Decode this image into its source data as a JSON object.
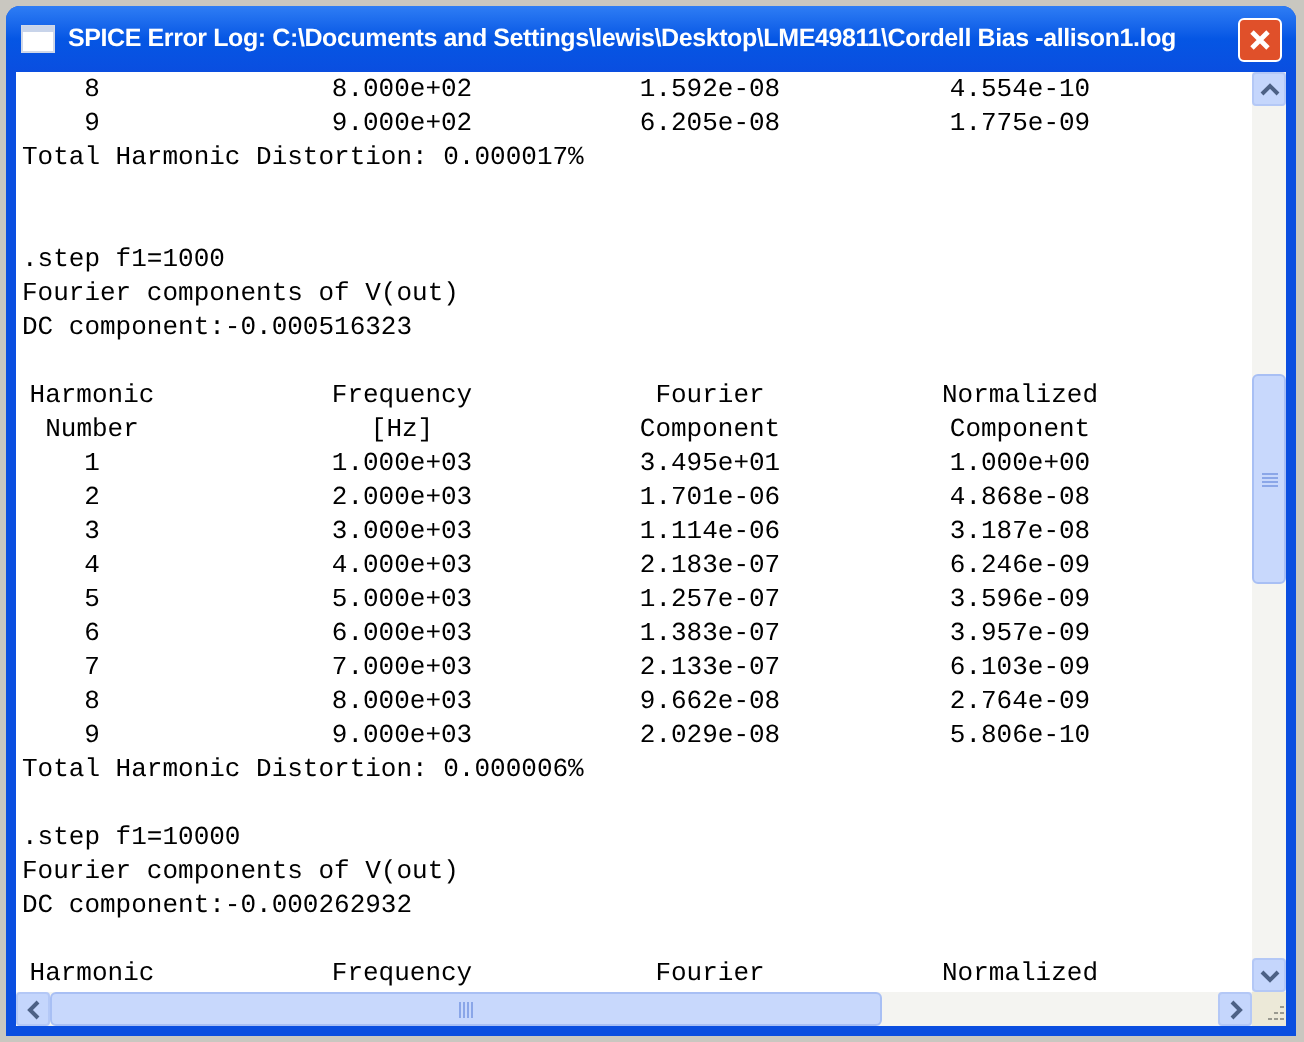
{
  "window": {
    "title": "SPICE Error Log: C:\\Documents and Settings\\lewis\\Desktop\\LME49811\\Cordell Bias -allison1.log"
  },
  "log": [
    {
      "kind": "row",
      "cells": [
        "8",
        "8.000e+02",
        "1.592e-08",
        "4.554e-10"
      ]
    },
    {
      "kind": "row",
      "cells": [
        "9",
        "9.000e+02",
        "6.205e-08",
        "1.775e-09"
      ]
    },
    {
      "kind": "text",
      "text": "Total Harmonic Distortion: 0.000017%"
    },
    {
      "kind": "blank"
    },
    {
      "kind": "blank"
    },
    {
      "kind": "text",
      "text": ".step f1=1000"
    },
    {
      "kind": "text",
      "text": "Fourier components of V(out)"
    },
    {
      "kind": "text",
      "text": "DC component:-0.000516323"
    },
    {
      "kind": "blank"
    },
    {
      "kind": "row",
      "cells": [
        "Harmonic",
        "Frequency",
        "Fourier",
        "Normalized"
      ]
    },
    {
      "kind": "row",
      "cells": [
        "Number",
        "[Hz]",
        "Component",
        "Component"
      ]
    },
    {
      "kind": "row",
      "cells": [
        "1",
        "1.000e+03",
        "3.495e+01",
        "1.000e+00"
      ]
    },
    {
      "kind": "row",
      "cells": [
        "2",
        "2.000e+03",
        "1.701e-06",
        "4.868e-08"
      ]
    },
    {
      "kind": "row",
      "cells": [
        "3",
        "3.000e+03",
        "1.114e-06",
        "3.187e-08"
      ]
    },
    {
      "kind": "row",
      "cells": [
        "4",
        "4.000e+03",
        "2.183e-07",
        "6.246e-09"
      ]
    },
    {
      "kind": "row",
      "cells": [
        "5",
        "5.000e+03",
        "1.257e-07",
        "3.596e-09"
      ]
    },
    {
      "kind": "row",
      "cells": [
        "6",
        "6.000e+03",
        "1.383e-07",
        "3.957e-09"
      ]
    },
    {
      "kind": "row",
      "cells": [
        "7",
        "7.000e+03",
        "2.133e-07",
        "6.103e-09"
      ]
    },
    {
      "kind": "row",
      "cells": [
        "8",
        "8.000e+03",
        "9.662e-08",
        "2.764e-09"
      ]
    },
    {
      "kind": "row",
      "cells": [
        "9",
        "9.000e+03",
        "2.029e-08",
        "5.806e-10"
      ]
    },
    {
      "kind": "text",
      "text": "Total Harmonic Distortion: 0.000006%"
    },
    {
      "kind": "blank"
    },
    {
      "kind": "text",
      "text": ".step f1=10000"
    },
    {
      "kind": "text",
      "text": "Fourier components of V(out)"
    },
    {
      "kind": "text",
      "text": "DC component:-0.000262932"
    },
    {
      "kind": "blank"
    },
    {
      "kind": "row",
      "cells": [
        "Harmonic",
        "Frequency",
        "Fourier",
        "Normalized"
      ]
    }
  ]
}
